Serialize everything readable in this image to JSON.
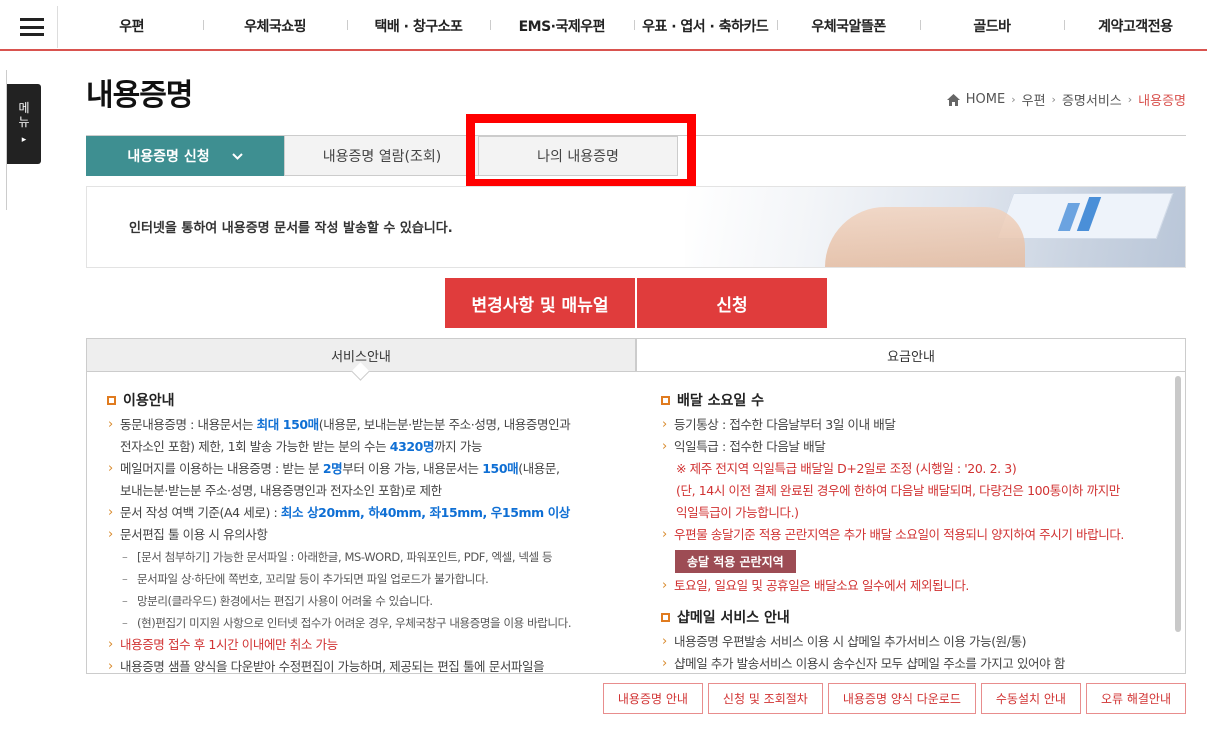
{
  "nav": {
    "menu_icon": "hamburger-icon",
    "items": [
      "우편",
      "우체국쇼핑",
      "택배 · 창구소포",
      "EMS·국제우편",
      "우표 · 엽서 · 축하카드",
      "우체국알뜰폰",
      "골드바",
      "계약고객전용"
    ]
  },
  "sidemenu": {
    "line1": "메",
    "line2": "뉴",
    "arrow": "▸"
  },
  "page": {
    "title": "내용증명"
  },
  "breadcrumb": {
    "home": "HOME",
    "items": [
      "우편",
      "증명서비스"
    ],
    "current": "내용증명",
    "sep": "›"
  },
  "tabs": {
    "apply": "내용증명 신청",
    "view": "내용증명 열람(조회)",
    "mine": "나의 내용증명"
  },
  "banner": {
    "text": "인터넷을 통하여 내용증명 문서를 작성 발송할 수 있습니다."
  },
  "buttons": {
    "manual": "변경사항 및 매뉴얼",
    "apply": "신청"
  },
  "service_tabs": {
    "service": "서비스안내",
    "fee": "요금안내"
  },
  "usage": {
    "title": "이용안내",
    "l1a": "동문내용증명 : 내용문서는 ",
    "l1b": "최대 150매",
    "l1c": "(내용문, 보내는분·받는분 주소·성명, 내용증명인과",
    "l1d": "전자소인 포함) 제한, 1회 발송 가능한 받는 분의 수는 ",
    "l1e": "4320명",
    "l1f": "까지 가능",
    "l2a": "메일머지를 이용하는 내용증명 : 받는 분 ",
    "l2b": "2명",
    "l2c": "부터 이용 가능, 내용문서는 ",
    "l2d": "150매",
    "l2e": "(내용문,",
    "l2f": "보내는분·받는분 주소·성명, 내용증명인과 전자소인 포함)로 제한",
    "l3a": "문서 작성 여백 기준(A4 세로) : ",
    "l3b": "최소 상20mm, 하40mm, 좌15mm, 우15mm 이상",
    "l4": "문서편집 툴 이용 시 유의사항",
    "s1": "[문서 첨부하기] 가능한 문서파일 : 아래한글, MS-WORD, 파워포인트, PDF, 엑셀, 넥셀 등",
    "s2": "문서파일 상·하단에 쪽번호, 꼬리말 등이 추가되면 파일 업로드가 불가합니다.",
    "s3": "망분리(클라우드) 환경에서는 편집기 사용이 어려울 수 있습니다.",
    "s4": "(현)편집기 미지원 사항으로 인터넷 접수가 어려운 경우, 우체국창구 내용증명을 이용 바랍니다.",
    "l5": "내용증명 접수 후 1시간 이내에만 취소 가능",
    "l6": "내용증명 샘플 양식을 다운받아 수정편집이 가능하며, 제공되는 편집 툴에 문서파일을"
  },
  "delivery": {
    "title": "배달 소요일 수",
    "l1": "등기통상 : 접수한 다음날부터 3일 이내 배달",
    "l2": "익일특급 : 접수한 다음날 배달",
    "n1": "※ 제주 전지역 익일특급 배달일 D+2일로 조정 (시행일 : '20. 2. 3)",
    "n2": "(단, 14시 이전 결제 완료된 경우에 한하여 다음날 배달되며, 다량건은 100통이하 까지만",
    "n3": "익일특급이 가능합니다.)",
    "l3": "우편물 송달기준 적용 곤란지역은 추가 배달 소요일이 적용되니 양지하여 주시기 바랍니다.",
    "area_btn": "송달 적용 곤란지역",
    "l4": "토요일, 일요일 및 공휴일은 배달소요 일수에서 제외됩니다."
  },
  "shopmail": {
    "title": "샵메일 서비스 안내",
    "l1": "내용증명 우편발송 서비스 이용 시 샵메일 추가서비스 이용 가능(원/통)",
    "l2": "샵메일 추가 발송서비스 이용시 송수신자 모두 샵메일 주소를 가지고 있어야 함"
  },
  "bottom_buttons": [
    "내용증명 안내",
    "신청 및 조회절차",
    "내용증명 양식 다운로드",
    "수동설치 안내",
    "오류 해결안내"
  ],
  "colors": {
    "accent_red": "#e03c3c",
    "tab_teal": "#3e8f91",
    "highlight_blue": "#0f6fd4",
    "box_red": "#ff0000"
  }
}
